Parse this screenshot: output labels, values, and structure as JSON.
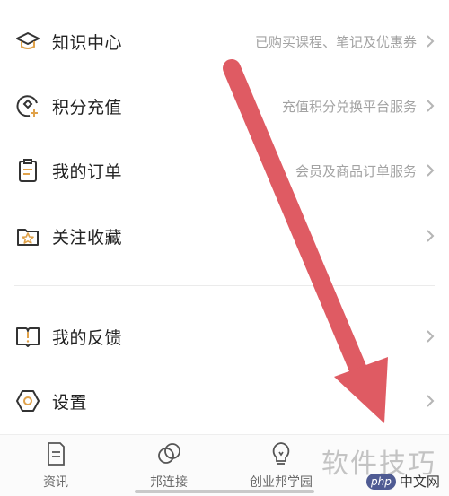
{
  "menu": {
    "items": [
      {
        "label": "知识中心",
        "desc": "已购买课程、笔记及优惠券",
        "icon": "graduation-cap-icon"
      },
      {
        "label": "积分充值",
        "desc": "充值积分兑换平台服务",
        "icon": "points-recharge-icon"
      },
      {
        "label": "我的订单",
        "desc": "会员及商品订单服务",
        "icon": "clipboard-icon"
      },
      {
        "label": "关注收藏",
        "desc": "",
        "icon": "star-folder-icon"
      },
      {
        "label": "我的反馈",
        "desc": "",
        "icon": "feedback-book-icon"
      },
      {
        "label": "设置",
        "desc": "",
        "icon": "hexagon-gear-icon"
      }
    ]
  },
  "tabbar": {
    "tabs": [
      {
        "label": "资讯",
        "icon": "document-icon"
      },
      {
        "label": "邦连接",
        "icon": "linked-circles-icon"
      },
      {
        "label": "创业邦学园",
        "icon": "lightbulb-icon"
      }
    ]
  },
  "watermark": {
    "text": "软件技巧",
    "site": "中文网",
    "badge": "php"
  },
  "colors": {
    "accent": "#e0a24a",
    "arrow": "#df5b63",
    "text": "#222222",
    "muted": "#a3a3a3"
  }
}
